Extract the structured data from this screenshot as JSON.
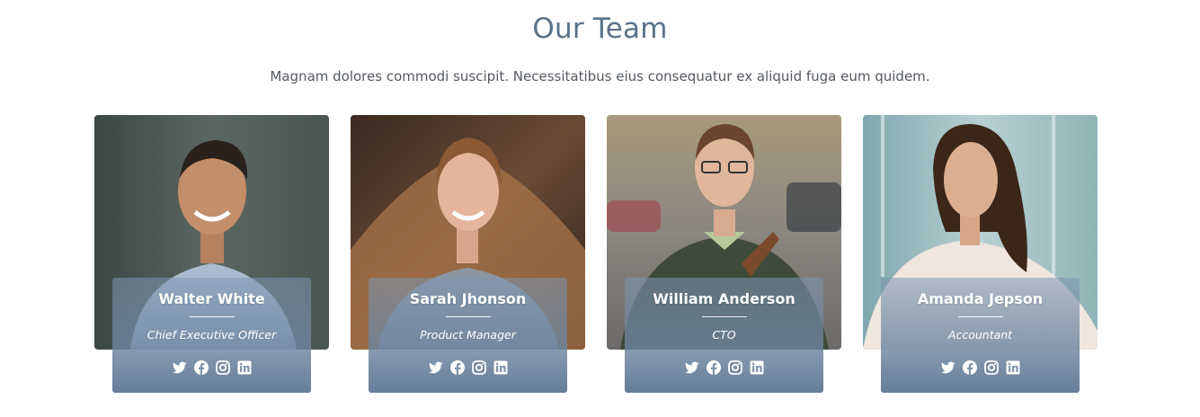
{
  "section": {
    "title": "Our Team",
    "subtitle": "Magnam dolores commodi suscipit. Necessitatibus eius consequatur ex aliquid fuga eum quidem."
  },
  "team": [
    {
      "name": "Walter White",
      "role": "Chief Executive Officer"
    },
    {
      "name": "Sarah Jhonson",
      "role": "Product Manager"
    },
    {
      "name": "William Anderson",
      "role": "CTO"
    },
    {
      "name": "Amanda Jepson",
      "role": "Accountant"
    }
  ],
  "social_icons": [
    "twitter-icon",
    "facebook-icon",
    "instagram-icon",
    "linkedin-icon"
  ],
  "colors": {
    "title": "#5b7289",
    "overlay": "#7d96b2"
  }
}
